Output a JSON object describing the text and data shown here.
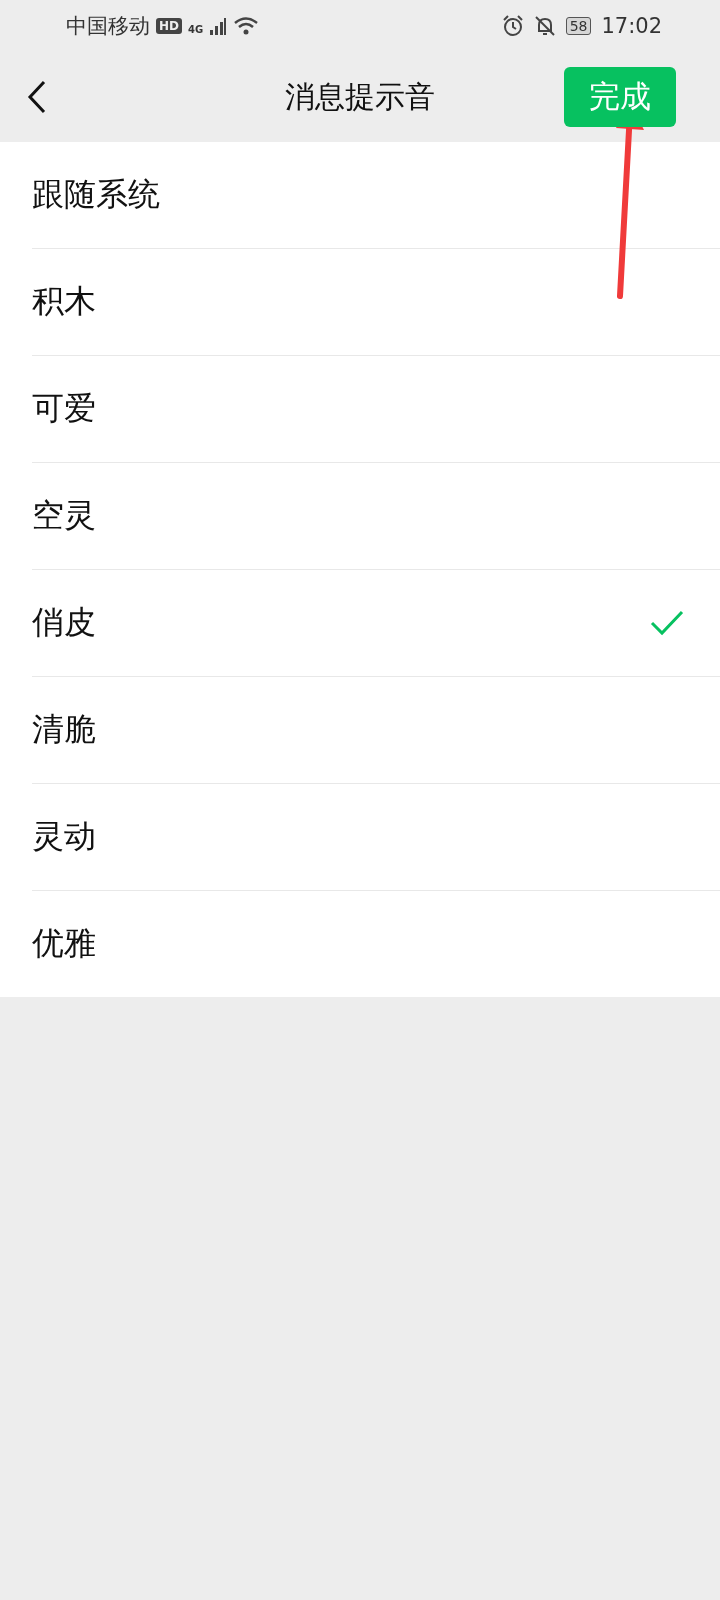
{
  "status_bar": {
    "carrier": "中国移动",
    "hd_badge": "HD",
    "network": "4G",
    "battery": "58",
    "time": "17:02"
  },
  "header": {
    "title": "消息提示音",
    "done_button": "完成"
  },
  "sounds": [
    {
      "label": "跟随系统",
      "selected": false
    },
    {
      "label": "积木",
      "selected": false
    },
    {
      "label": "可爱",
      "selected": false
    },
    {
      "label": "空灵",
      "selected": false
    },
    {
      "label": "俏皮",
      "selected": true
    },
    {
      "label": "清脆",
      "selected": false
    },
    {
      "label": "灵动",
      "selected": false
    },
    {
      "label": "优雅",
      "selected": false
    }
  ]
}
